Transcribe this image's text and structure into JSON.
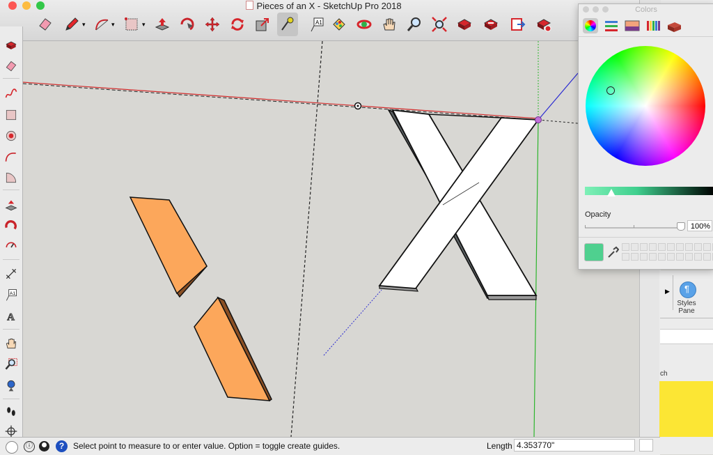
{
  "window": {
    "title": "Pieces of an X - SketchUp Pro 2018",
    "traffic_lights": [
      "#fc5753",
      "#fdbc40",
      "#33c748"
    ]
  },
  "toolbar": {
    "tools": [
      "eraser-icon",
      "pencil-icon",
      "arc-icon",
      "rectangle-icon",
      "push-pull-icon",
      "follow-me-icon",
      "move-icon",
      "rotate-icon",
      "scale-icon",
      "tape-measure-icon",
      "text-icon",
      "paint-bucket-icon",
      "orbit-icon",
      "pan-icon",
      "zoom-icon",
      "zoom-extents-icon",
      "previous-icon",
      "next-icon",
      "sections-icon",
      "extension-warehouse-icon"
    ],
    "active_tool": "tape-measure-icon",
    "text_tool_glyph": "A1"
  },
  "left_toolbar": {
    "tools": [
      "select-icon",
      "eraser-icon",
      "freehand-icon",
      "rectangle-icon",
      "polygon-icon",
      "arc-icon",
      "pie-icon",
      "push-pull-icon",
      "follow-me-icon",
      "offset-icon",
      "dimension-icon",
      "text-icon",
      "3d-text-icon",
      "pan-icon",
      "zoom-window-icon",
      "position-camera-icon",
      "walk-icon",
      "look-around-icon"
    ],
    "text_glyph": "A1",
    "text3d_glyph": "A"
  },
  "model": {
    "orange_color": "#fca75b",
    "orange_side_color": "#8a4f24",
    "x_face_color": "#ffffff",
    "x_side_color": "#5b6163",
    "axis_colors": {
      "red": "#d22b2b",
      "green": "#2cb52c",
      "blue": "#2b2bd2"
    },
    "cursor_point_color": "#c070d8"
  },
  "colors_panel": {
    "title": "Colors",
    "tabs": [
      "color-wheel-icon",
      "sliders-icon",
      "image-palette-icon",
      "pencils-icon",
      "brick-icon"
    ],
    "opacity_label": "Opacity",
    "opacity_value": "100%",
    "selected_color": "#4fd08f"
  },
  "styles_pane": {
    "label": "Styles\nPane",
    "partial_text": "ch",
    "yellow_color": "#fce634"
  },
  "status": {
    "message": "Select point to measure to or enter value.  Option = toggle create guides.",
    "length_label": "Length",
    "length_value": "4.353770\""
  }
}
